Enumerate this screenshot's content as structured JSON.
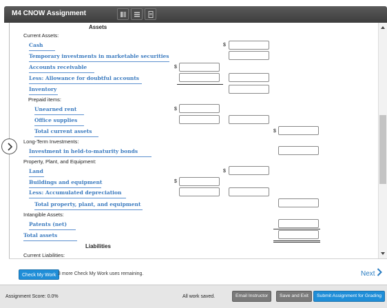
{
  "window": {
    "title": "M4 CNOW Assignment",
    "toolbar_icons": [
      "book-icon",
      "list-icon",
      "document-icon"
    ]
  },
  "sheet": {
    "assets_heading": "Assets",
    "current_assets_label": "Current Assets:",
    "cash": "Cash",
    "temporary_investments": "Temporary investments in marketable securities",
    "accounts_receivable": "Accounts receivable",
    "less_allowance": "Less: Allowance for doubtful accounts",
    "inventory": "Inventory",
    "prepaid_items_label": "Prepaid items:",
    "unearned_rent": "Unearned rent",
    "office_supplies": "Office supplies",
    "total_current_assets": "Total current assets",
    "long_term_investments_label": "Long-Term Investments:",
    "investment_htm": "Investment in held-to-maturity bonds",
    "ppe_label": "Property, Plant, and Equipment:",
    "land": "Land",
    "buildings_equipment": "Buildings and equipment",
    "less_accum_depr": "Less: Accumulated depreciation",
    "total_ppe": "Total property, plant, and equipment",
    "intangible_label": "Intangible Assets:",
    "patents": "Patents (net)",
    "total_assets": "Total assets",
    "liabilities_heading": "Liabilities",
    "current_liabilities_label": "Current Liabilities:",
    "dollar_sign": "$"
  },
  "check": {
    "button_label": "Check My Work",
    "remaining_note": "3 more Check My Work uses remaining.",
    "next_label": "Next"
  },
  "footer": {
    "score": "Assignment Score: 0.0%",
    "saved_status": "All work saved.",
    "email_instructor": "Email Instructor",
    "save_exit": "Save and Exit",
    "submit": "Submit Assignment for Grading"
  },
  "colors": {
    "link": "#3a7abf",
    "accent": "#1f8ed8",
    "titlebar": "#4a4a4a"
  }
}
